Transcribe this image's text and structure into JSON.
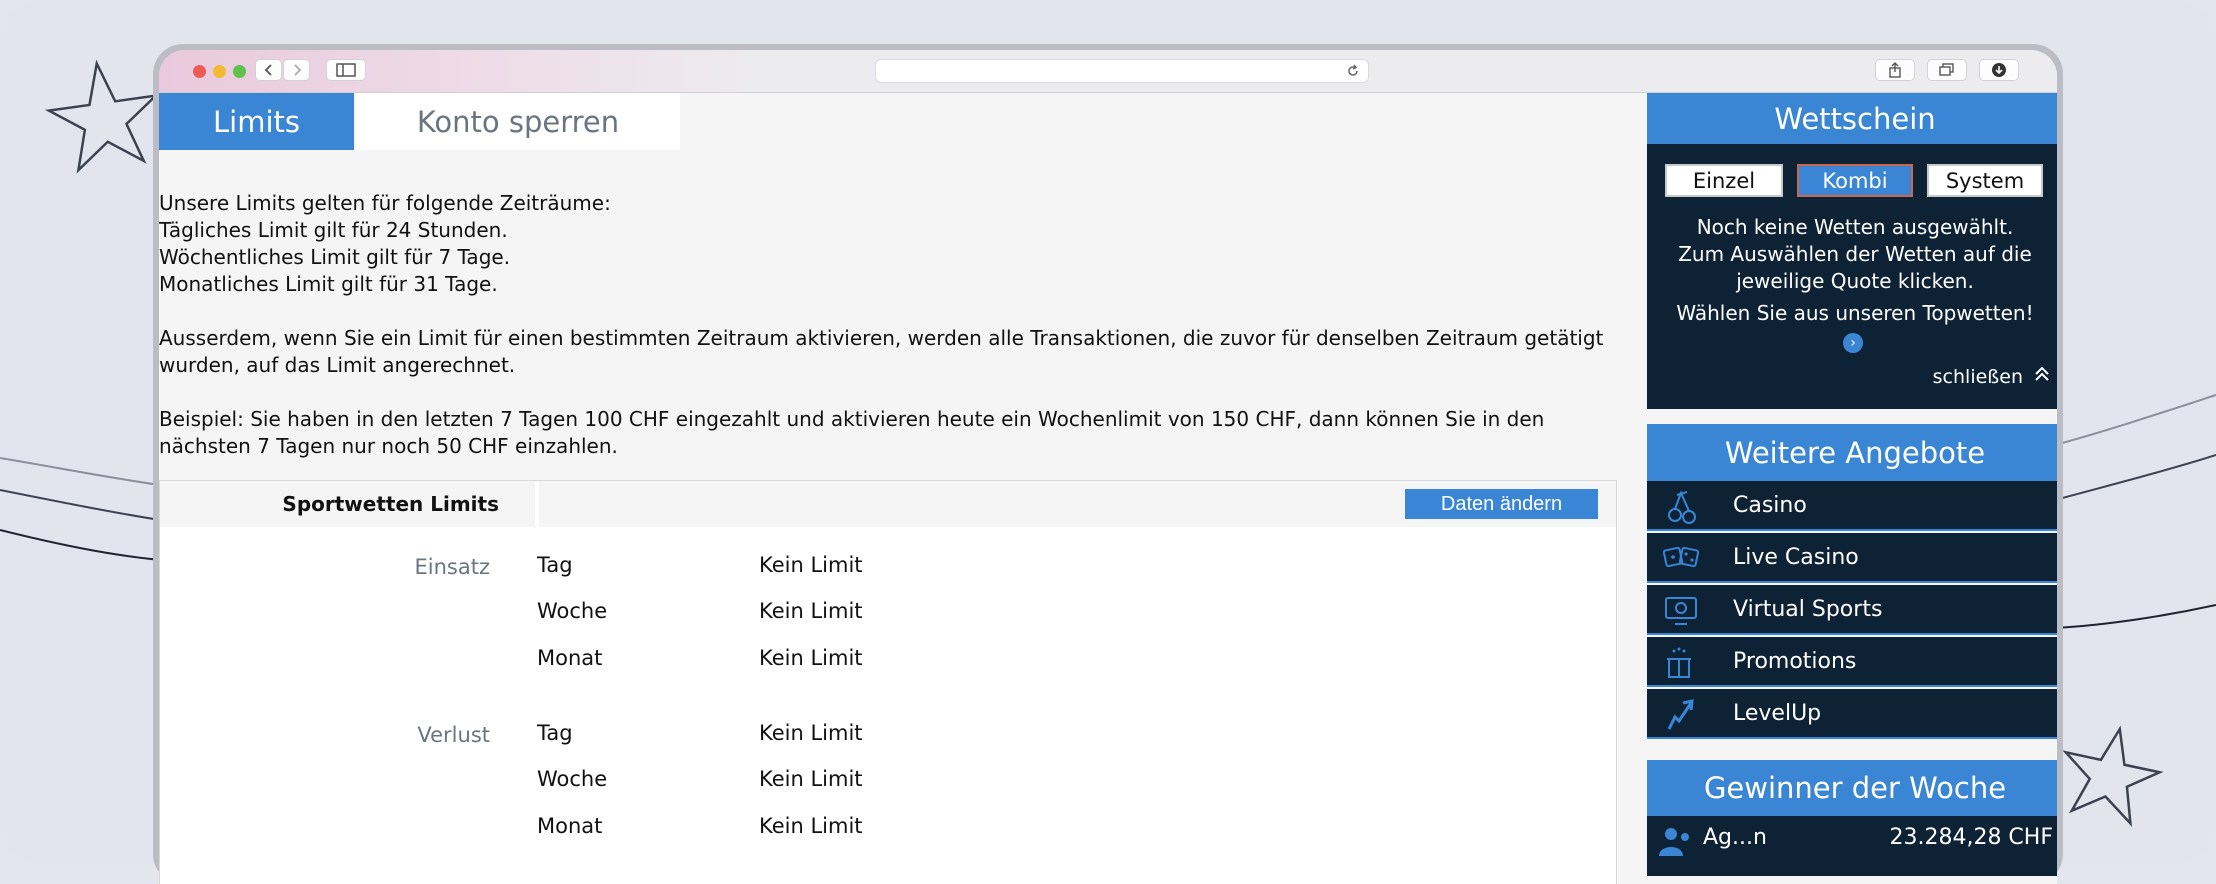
{
  "tabs": {
    "limits": "Limits",
    "sperren": "Konto sperren"
  },
  "info": {
    "line1": "Unsere Limits gelten für folgende Zeiträume:",
    "line2": "Tägliches Limit gilt für 24 Stunden.",
    "line3": "Wöchentliches Limit gilt für 7 Tage.",
    "line4": "Monatliches Limit gilt für 31 Tage.",
    "para2": "Ausserdem, wenn Sie ein Limit für einen bestimmten Zeitraum aktivieren, werden alle Transaktionen, die zuvor für denselben Zeitraum getätigt wurden, auf das Limit angerechnet.",
    "para3": "Beispiel: Sie haben in den letzten 7 Tagen 100 CHF eingezahlt und aktivieren heute ein Wochenlimit von 150 CHF, dann können Sie in den nächsten 7 Tagen nur noch 50 CHF einzahlen."
  },
  "limits_table": {
    "title": "Sportwetten Limits",
    "edit_button": "Daten ändern",
    "groups": [
      {
        "name": "Einsatz",
        "rows": [
          {
            "period": "Tag",
            "value": "Kein Limit"
          },
          {
            "period": "Woche",
            "value": "Kein Limit"
          },
          {
            "period": "Monat",
            "value": "Kein Limit"
          }
        ]
      },
      {
        "name": "Verlust",
        "rows": [
          {
            "period": "Tag",
            "value": "Kein Limit"
          },
          {
            "period": "Woche",
            "value": "Kein Limit"
          },
          {
            "period": "Monat",
            "value": "Kein Limit"
          }
        ]
      }
    ]
  },
  "wettschein": {
    "title": "Wettschein",
    "tabs": [
      "Einzel",
      "Kombi",
      "System"
    ],
    "active_tab": "Kombi",
    "message_line1": "Noch keine Wetten ausgewählt.",
    "message_line2": "Zum Auswählen der Wetten auf die",
    "message_line3": "jeweilige Quote klicken.",
    "topwetten": "Wählen Sie aus unseren Topwetten!",
    "close": "schließen"
  },
  "weitere_angebote": {
    "title": "Weitere Angebote",
    "items": [
      {
        "label": "Casino",
        "icon": "cherries-icon"
      },
      {
        "label": "Live Casino",
        "icon": "dice-icon"
      },
      {
        "label": "Virtual Sports",
        "icon": "monitor-ball-icon"
      },
      {
        "label": "Promotions",
        "icon": "gift-icon"
      },
      {
        "label": "LevelUp",
        "icon": "levelup-arrow-icon"
      }
    ]
  },
  "gewinner": {
    "title": "Gewinner der Woche",
    "winner_name": "Ag...n",
    "winner_amount": "23.284,28 CHF"
  },
  "colors": {
    "accent": "#3a86d4",
    "sidebar_dark": "#0e2236",
    "page_bg": "#f5f5f5"
  }
}
